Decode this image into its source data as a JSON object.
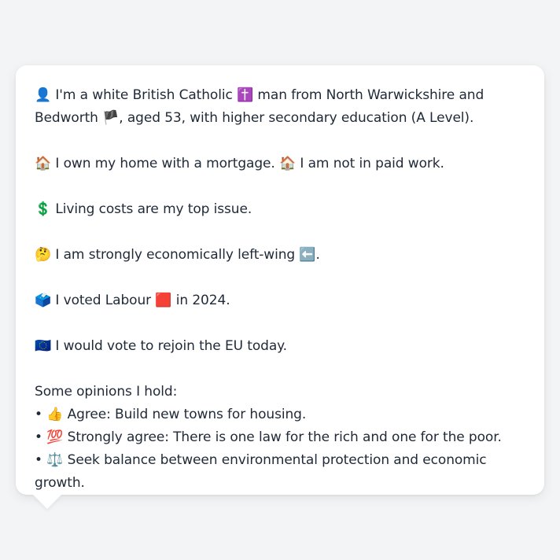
{
  "profile": {
    "identity": {
      "icon": "👤",
      "text1": "I'm a white British Catholic ",
      "religion_icon": "✝️",
      "text2": " man from North Warwickshire and Bedworth ",
      "flag_icon": "🏴",
      "text3": ", aged 53, with higher secondary education (A Level)."
    },
    "home": {
      "icon": "🏠",
      "text1": "I own my home with a mortgage. ",
      "icon2": "🏠",
      "text2": "I am not in paid work."
    },
    "issue": {
      "icon": "💲",
      "text": "Living costs are my top issue."
    },
    "economics": {
      "icon": "🤔",
      "text": "I am strongly economically left-wing ",
      "arrow_icon": "⬅️",
      "suffix": "."
    },
    "vote": {
      "icon": "🗳️",
      "text1": "I voted Labour ",
      "party_icon": "🟥",
      "text2": " in 2024."
    },
    "eu": {
      "icon": "🇪🇺",
      "text": "I would vote to rejoin the EU today."
    },
    "opinions": {
      "heading": "Some opinions I hold:",
      "bullet": "•",
      "items": [
        {
          "icon": "👍",
          "text": "Agree: Build new towns for housing."
        },
        {
          "icon": "💯",
          "text": "Strongly agree: There is one law for the rich and one for the poor."
        },
        {
          "icon": "⚖️",
          "text": "Seek balance between environmental protection and economic growth."
        }
      ]
    }
  }
}
